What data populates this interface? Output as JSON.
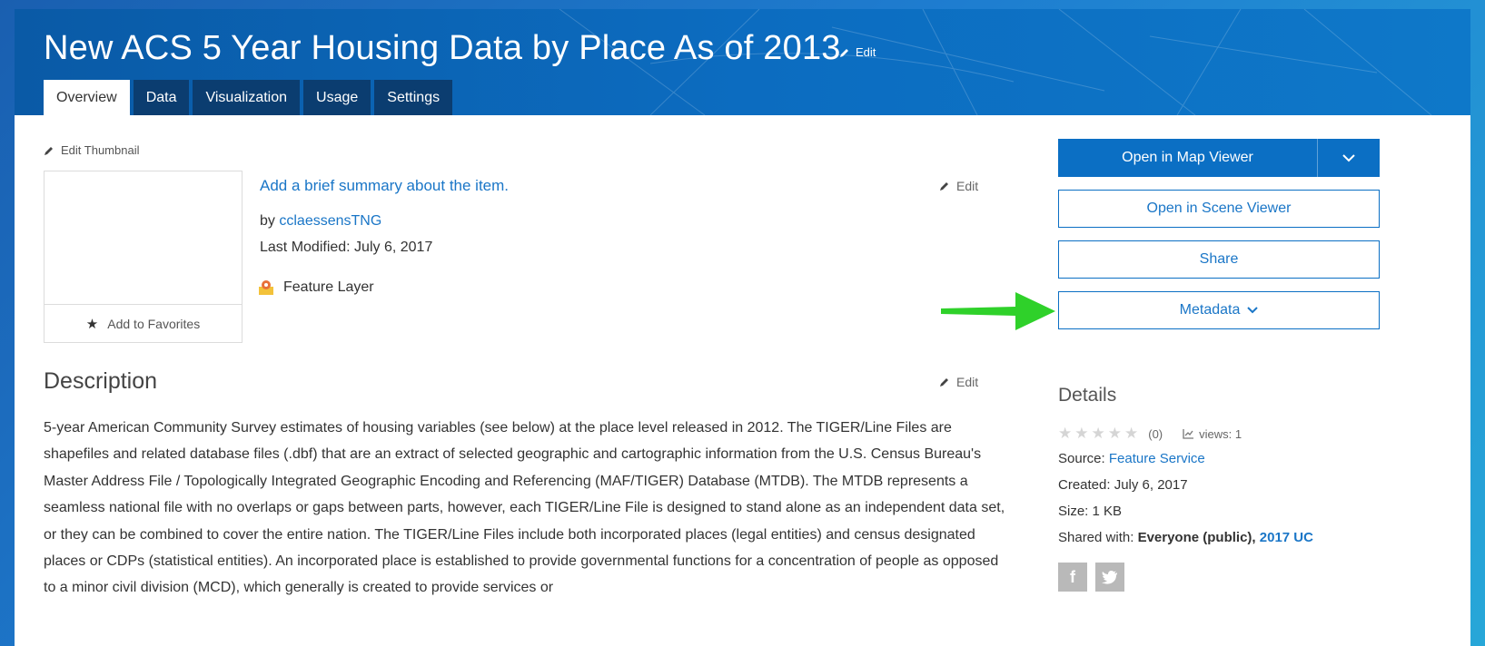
{
  "header": {
    "title": "New ACS 5 Year Housing Data by Place As of 2013",
    "edit_label": "Edit",
    "tabs": [
      {
        "label": "Overview"
      },
      {
        "label": "Data"
      },
      {
        "label": "Visualization"
      },
      {
        "label": "Usage"
      },
      {
        "label": "Settings"
      }
    ]
  },
  "thumbnail": {
    "edit_label": "Edit Thumbnail",
    "favorites_label": "Add to Favorites"
  },
  "summary": {
    "prompt": "Add a brief summary about the item.",
    "edit_label": "Edit",
    "by_prefix": "by",
    "author": "cclaessensTNG",
    "last_modified": "Last Modified: July 6, 2017",
    "item_type": "Feature Layer"
  },
  "description": {
    "title": "Description",
    "edit_label": "Edit",
    "body": "5-year American Community Survey estimates of housing variables (see below) at the place level released in 2012. The TIGER/Line Files are shapefiles and related database files (.dbf) that are an extract of selected geographic and cartographic information from the U.S. Census Bureau's Master Address File / Topologically Integrated Geographic Encoding and Referencing (MAF/TIGER) Database (MTDB). The MTDB represents a seamless national file with no overlaps or gaps between parts, however, each TIGER/Line File is designed to stand alone as an independent data set, or they can be combined to cover the entire nation. The TIGER/Line Files include both incorporated places (legal entities) and census designated places or CDPs (statistical entities). An incorporated place is established to provide governmental functions for a concentration of people as opposed to a minor civil division (MCD), which generally is created to provide services or"
  },
  "actions": {
    "open_map_viewer": "Open in Map Viewer",
    "open_scene_viewer": "Open in Scene Viewer",
    "share": "Share",
    "metadata": "Metadata"
  },
  "details": {
    "title": "Details",
    "rating_count": "(0)",
    "views": "views: 1",
    "source_label": "Source:",
    "source_value": "Feature Service",
    "created": "Created: July 6, 2017",
    "size": "Size: 1 KB",
    "shared_label": "Shared with:",
    "shared_value": "Everyone (public),",
    "shared_group": "2017 UC"
  },
  "colors": {
    "brand_blue": "#0b6fc4",
    "link_blue": "#1a76c7",
    "tab_dark": "#0b3d70",
    "arrow_green": "#2fd12a"
  }
}
